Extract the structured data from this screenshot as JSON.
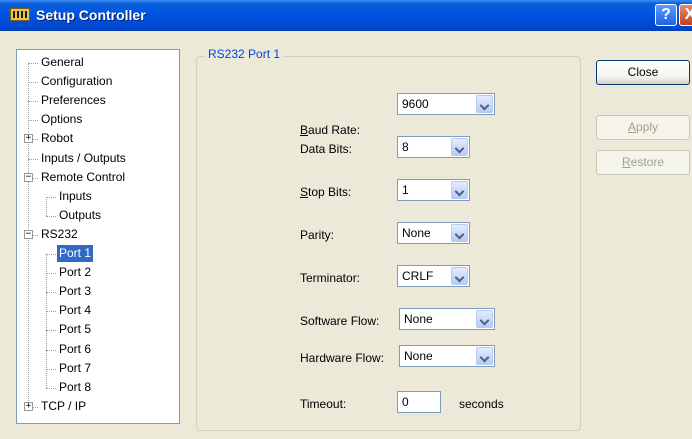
{
  "window": {
    "title": "Setup Controller",
    "help_label": "?",
    "close_label": "X"
  },
  "tree": {
    "items": [
      {
        "label": "General",
        "level": 1
      },
      {
        "label": "Configuration",
        "level": 1
      },
      {
        "label": "Preferences",
        "level": 1
      },
      {
        "label": "Options",
        "level": 1
      },
      {
        "label": "Robot",
        "level": 1,
        "expander": "+"
      },
      {
        "label": "Inputs / Outputs",
        "level": 1
      },
      {
        "label": "Remote Control",
        "level": 1,
        "expander": "−"
      },
      {
        "label": "Inputs",
        "level": 2
      },
      {
        "label": "Outputs",
        "level": 2
      },
      {
        "label": "RS232",
        "level": 1,
        "expander": "−"
      },
      {
        "label": "Port 1",
        "level": 2,
        "selected": true
      },
      {
        "label": "Port 2",
        "level": 2
      },
      {
        "label": "Port 3",
        "level": 2
      },
      {
        "label": "Port 4",
        "level": 2
      },
      {
        "label": "Port 5",
        "level": 2
      },
      {
        "label": "Port 6",
        "level": 2
      },
      {
        "label": "Port 7",
        "level": 2
      },
      {
        "label": "Port 8",
        "level": 2
      },
      {
        "label": "TCP / IP",
        "level": 1,
        "expander": "+"
      }
    ]
  },
  "group": {
    "title": "RS232 Port 1"
  },
  "form": {
    "baud_rate": {
      "label_pre": "",
      "label_u": "B",
      "label_post": "aud Rate:",
      "value": "9600"
    },
    "data_bits": {
      "label": "Data Bits:",
      "value": "8"
    },
    "stop_bits": {
      "label_pre": "",
      "label_u": "S",
      "label_post": "top Bits:",
      "value": "1"
    },
    "parity": {
      "label": "Parity:",
      "value": "None"
    },
    "terminator": {
      "label": "Terminator:",
      "value": "CRLF"
    },
    "software_flow": {
      "label": "Software Flow:",
      "value": "None"
    },
    "hardware_flow": {
      "label": "Hardware Flow:",
      "value": "None"
    },
    "timeout": {
      "label": "Timeout:",
      "value": "0",
      "unit": "seconds"
    }
  },
  "buttons": {
    "close": "Close",
    "apply_u": "A",
    "apply_rest": "pply",
    "restore_u": "R",
    "restore_rest": "estore"
  }
}
